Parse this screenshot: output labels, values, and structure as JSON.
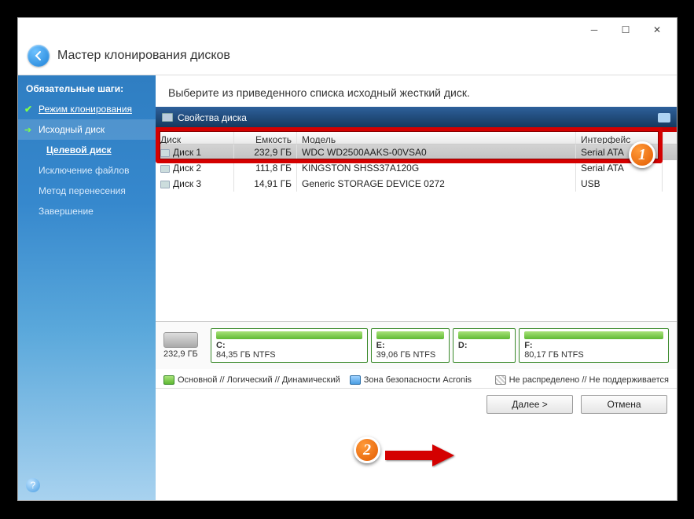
{
  "window": {
    "title": "Мастер клонирования дисков"
  },
  "sidebar": {
    "group": "Обязательные шаги:",
    "steps": [
      {
        "label": "Режим клонирования"
      },
      {
        "label": "Исходный диск"
      },
      {
        "label": "Целевой диск"
      },
      {
        "label": "Исключение файлов"
      },
      {
        "label": "Метод перенесения"
      },
      {
        "label": "Завершение"
      }
    ]
  },
  "main": {
    "instruction": "Выберите из приведенного списка исходный жесткий диск.",
    "toolbar": {
      "props_label": "Свойства диска"
    },
    "columns": {
      "disk": "Диск",
      "capacity": "Емкость",
      "model": "Модель",
      "iface": "Интерфейс"
    },
    "rows": [
      {
        "disk": "Диск 1",
        "capacity": "232,9 ГБ",
        "model": "WDC WD2500AAKS-00VSA0",
        "iface": "Serial ATA"
      },
      {
        "disk": "Диск 2",
        "capacity": "111,8 ГБ",
        "model": "KINGSTON SHSS37A120G",
        "iface": "Serial ATA"
      },
      {
        "disk": "Диск 3",
        "capacity": "14,91 ГБ",
        "model": "Generic STORAGE DEVICE 0272",
        "iface": "USB"
      }
    ],
    "disk_total": "232,9 ГБ",
    "partitions": [
      {
        "letter": "C:",
        "info": "84,35 ГБ  NTFS",
        "flex": 84
      },
      {
        "letter": "E:",
        "info": "39,06 ГБ  NTFS",
        "flex": 39
      },
      {
        "letter": "D:",
        "info": "",
        "flex": 30
      },
      {
        "letter": "F:",
        "info": "80,17 ГБ  NTFS",
        "flex": 80
      }
    ],
    "legend": {
      "primary": "Основной // Логический // Динамический",
      "acronis": "Зона безопасности Acronis",
      "unalloc": "Не распределено // Не поддерживается"
    }
  },
  "footer": {
    "next": "Далее >",
    "cancel": "Отмена"
  },
  "annotations": {
    "b1": "1",
    "b2": "2"
  }
}
